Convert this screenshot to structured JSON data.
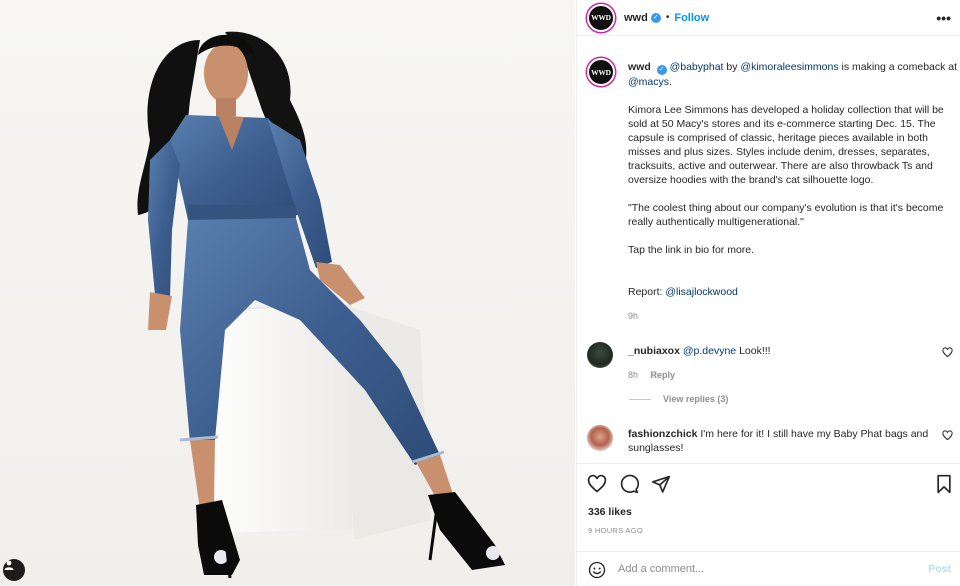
{
  "post": {
    "username": "wwd",
    "avatar_text": "WWD",
    "separator": "•",
    "follow_label": "Follow",
    "more_label": "•••"
  },
  "caption": {
    "username": "wwd",
    "mention_brand": "@babyphat",
    "by_text": "by",
    "mention_designer": "@kimoraleesimmons",
    "comeback_text": "is making a comeback at",
    "mention_store": "@macys",
    "period": ".",
    "paragraph_1": "Kimora Lee Simmons has developed a holiday collection that will be sold at 50 Macy's stores and its e-commerce starting Dec. 15. The capsule is comprised of classic, heritage pieces available in both misses and plus sizes. Styles include denim, dresses, separates, tracksuits, active and outerwear. There are also throwback Ts and oversize hoodies with the brand's cat silhouette logo.",
    "paragraph_2": "\"The coolest thing about our company's evolution is that it's become really authentically multigenerational.\"",
    "paragraph_3": "Tap the link in bio for more.",
    "report_label": "Report:",
    "report_mention": "@lisajlockwood",
    "time": "9h"
  },
  "comments": [
    {
      "username": "_nubiaxox",
      "mention": "@p.devyne",
      "text": "Look!!!",
      "time": "8h",
      "reply_label": "Reply",
      "view_replies": "View replies (3)"
    },
    {
      "username": "fashionzchick",
      "text": "I'm here for it! I still have my Baby Phat bags and sunglasses!"
    }
  ],
  "likes": "336 likes",
  "post_date": "9 HOURS AGO",
  "comment_box": {
    "placeholder": "Add a comment...",
    "post_label": "Post"
  },
  "colors": {
    "link_blue": "#0095f6",
    "mention_blue": "#00376b",
    "muted": "#8e8e8e",
    "post_disabled": "#b2dffc",
    "verified_blue": "#3897f0"
  },
  "icons": [
    "heart-icon",
    "comment-icon",
    "share-icon",
    "bookmark-icon",
    "emoji-icon",
    "user-tag-icon",
    "more-icon",
    "verified-icon"
  ]
}
